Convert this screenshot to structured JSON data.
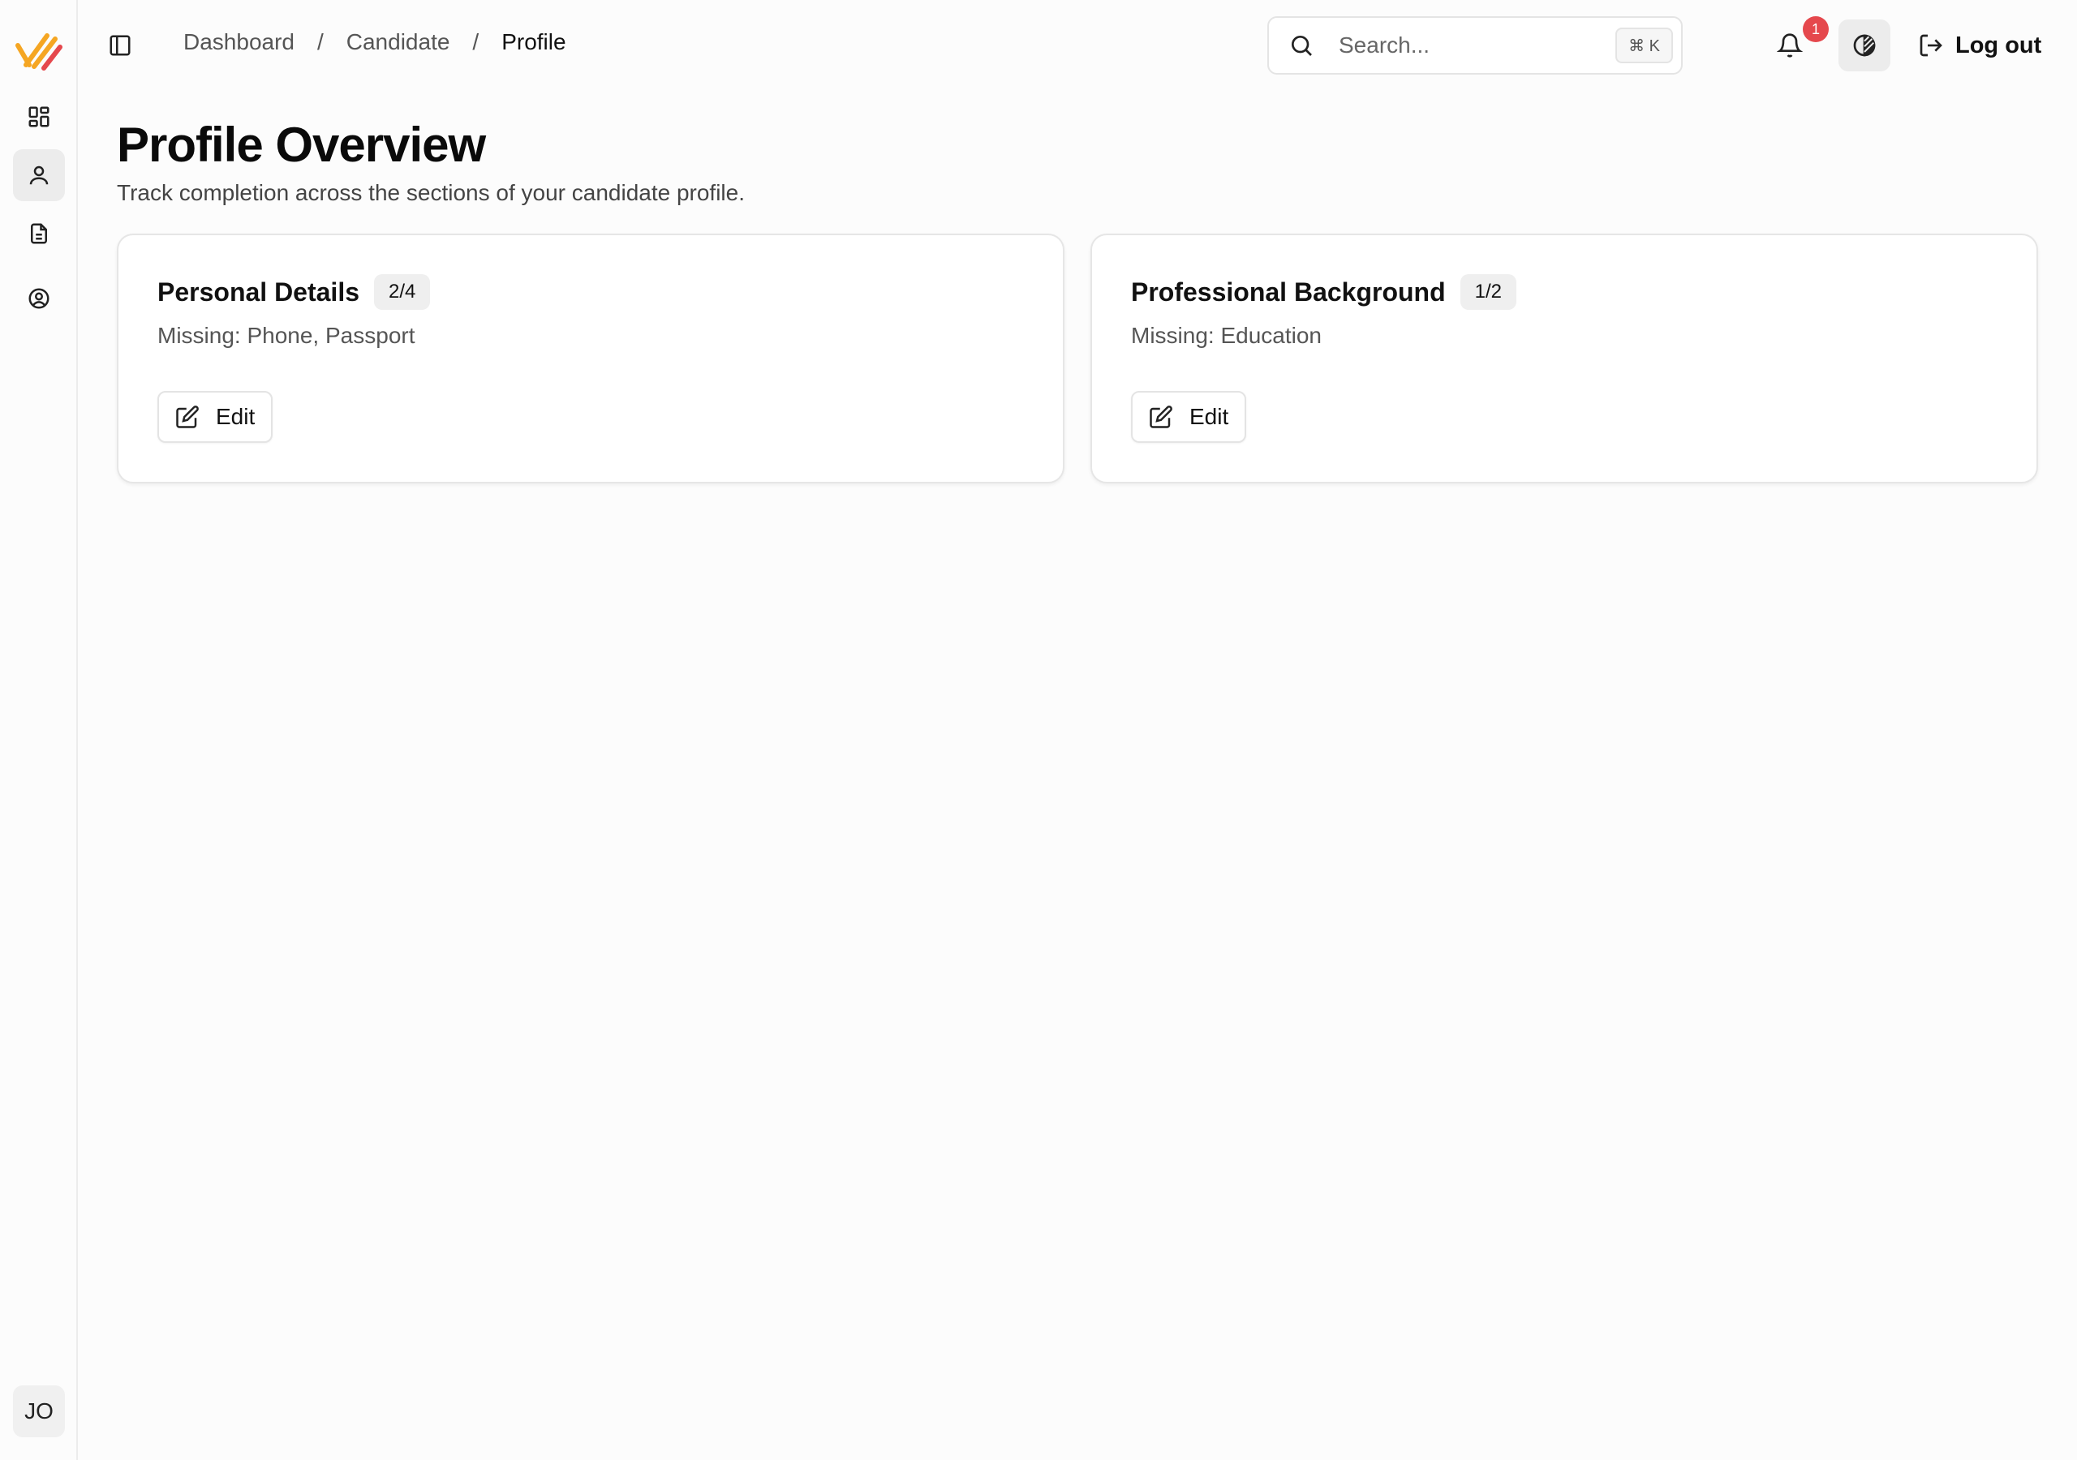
{
  "sidebar": {
    "logo_icon": "brand-stripes-logo",
    "items": [
      {
        "name": "dashboard",
        "icon": "dashboard-grid-icon",
        "active": false
      },
      {
        "name": "profile",
        "icon": "user-icon",
        "active": true
      },
      {
        "name": "documents",
        "icon": "document-icon",
        "active": false
      },
      {
        "name": "account",
        "icon": "user-circle-icon",
        "active": false
      }
    ],
    "avatar_initials": "JO"
  },
  "header": {
    "breadcrumb": [
      "Dashboard",
      "Candidate",
      "Profile"
    ],
    "breadcrumb_separator": "/",
    "search": {
      "placeholder": "Search...",
      "shortcut": "⌘ K"
    },
    "notifications_count": "1",
    "logout_label": "Log out"
  },
  "main": {
    "title": "Profile Overview",
    "subtitle": "Track completion across the sections of your candidate profile.",
    "cards": [
      {
        "title": "Personal Details",
        "count": "2/4",
        "missing": "Missing: Phone, Passport",
        "edit_label": "Edit"
      },
      {
        "title": "Professional Background",
        "count": "1/2",
        "missing": "Missing: Education",
        "edit_label": "Edit"
      }
    ]
  },
  "colors": {
    "logo_orange": "#f5a623",
    "logo_red": "#e5484d",
    "badge": "#e5484d",
    "active_nav": "#ececec"
  }
}
